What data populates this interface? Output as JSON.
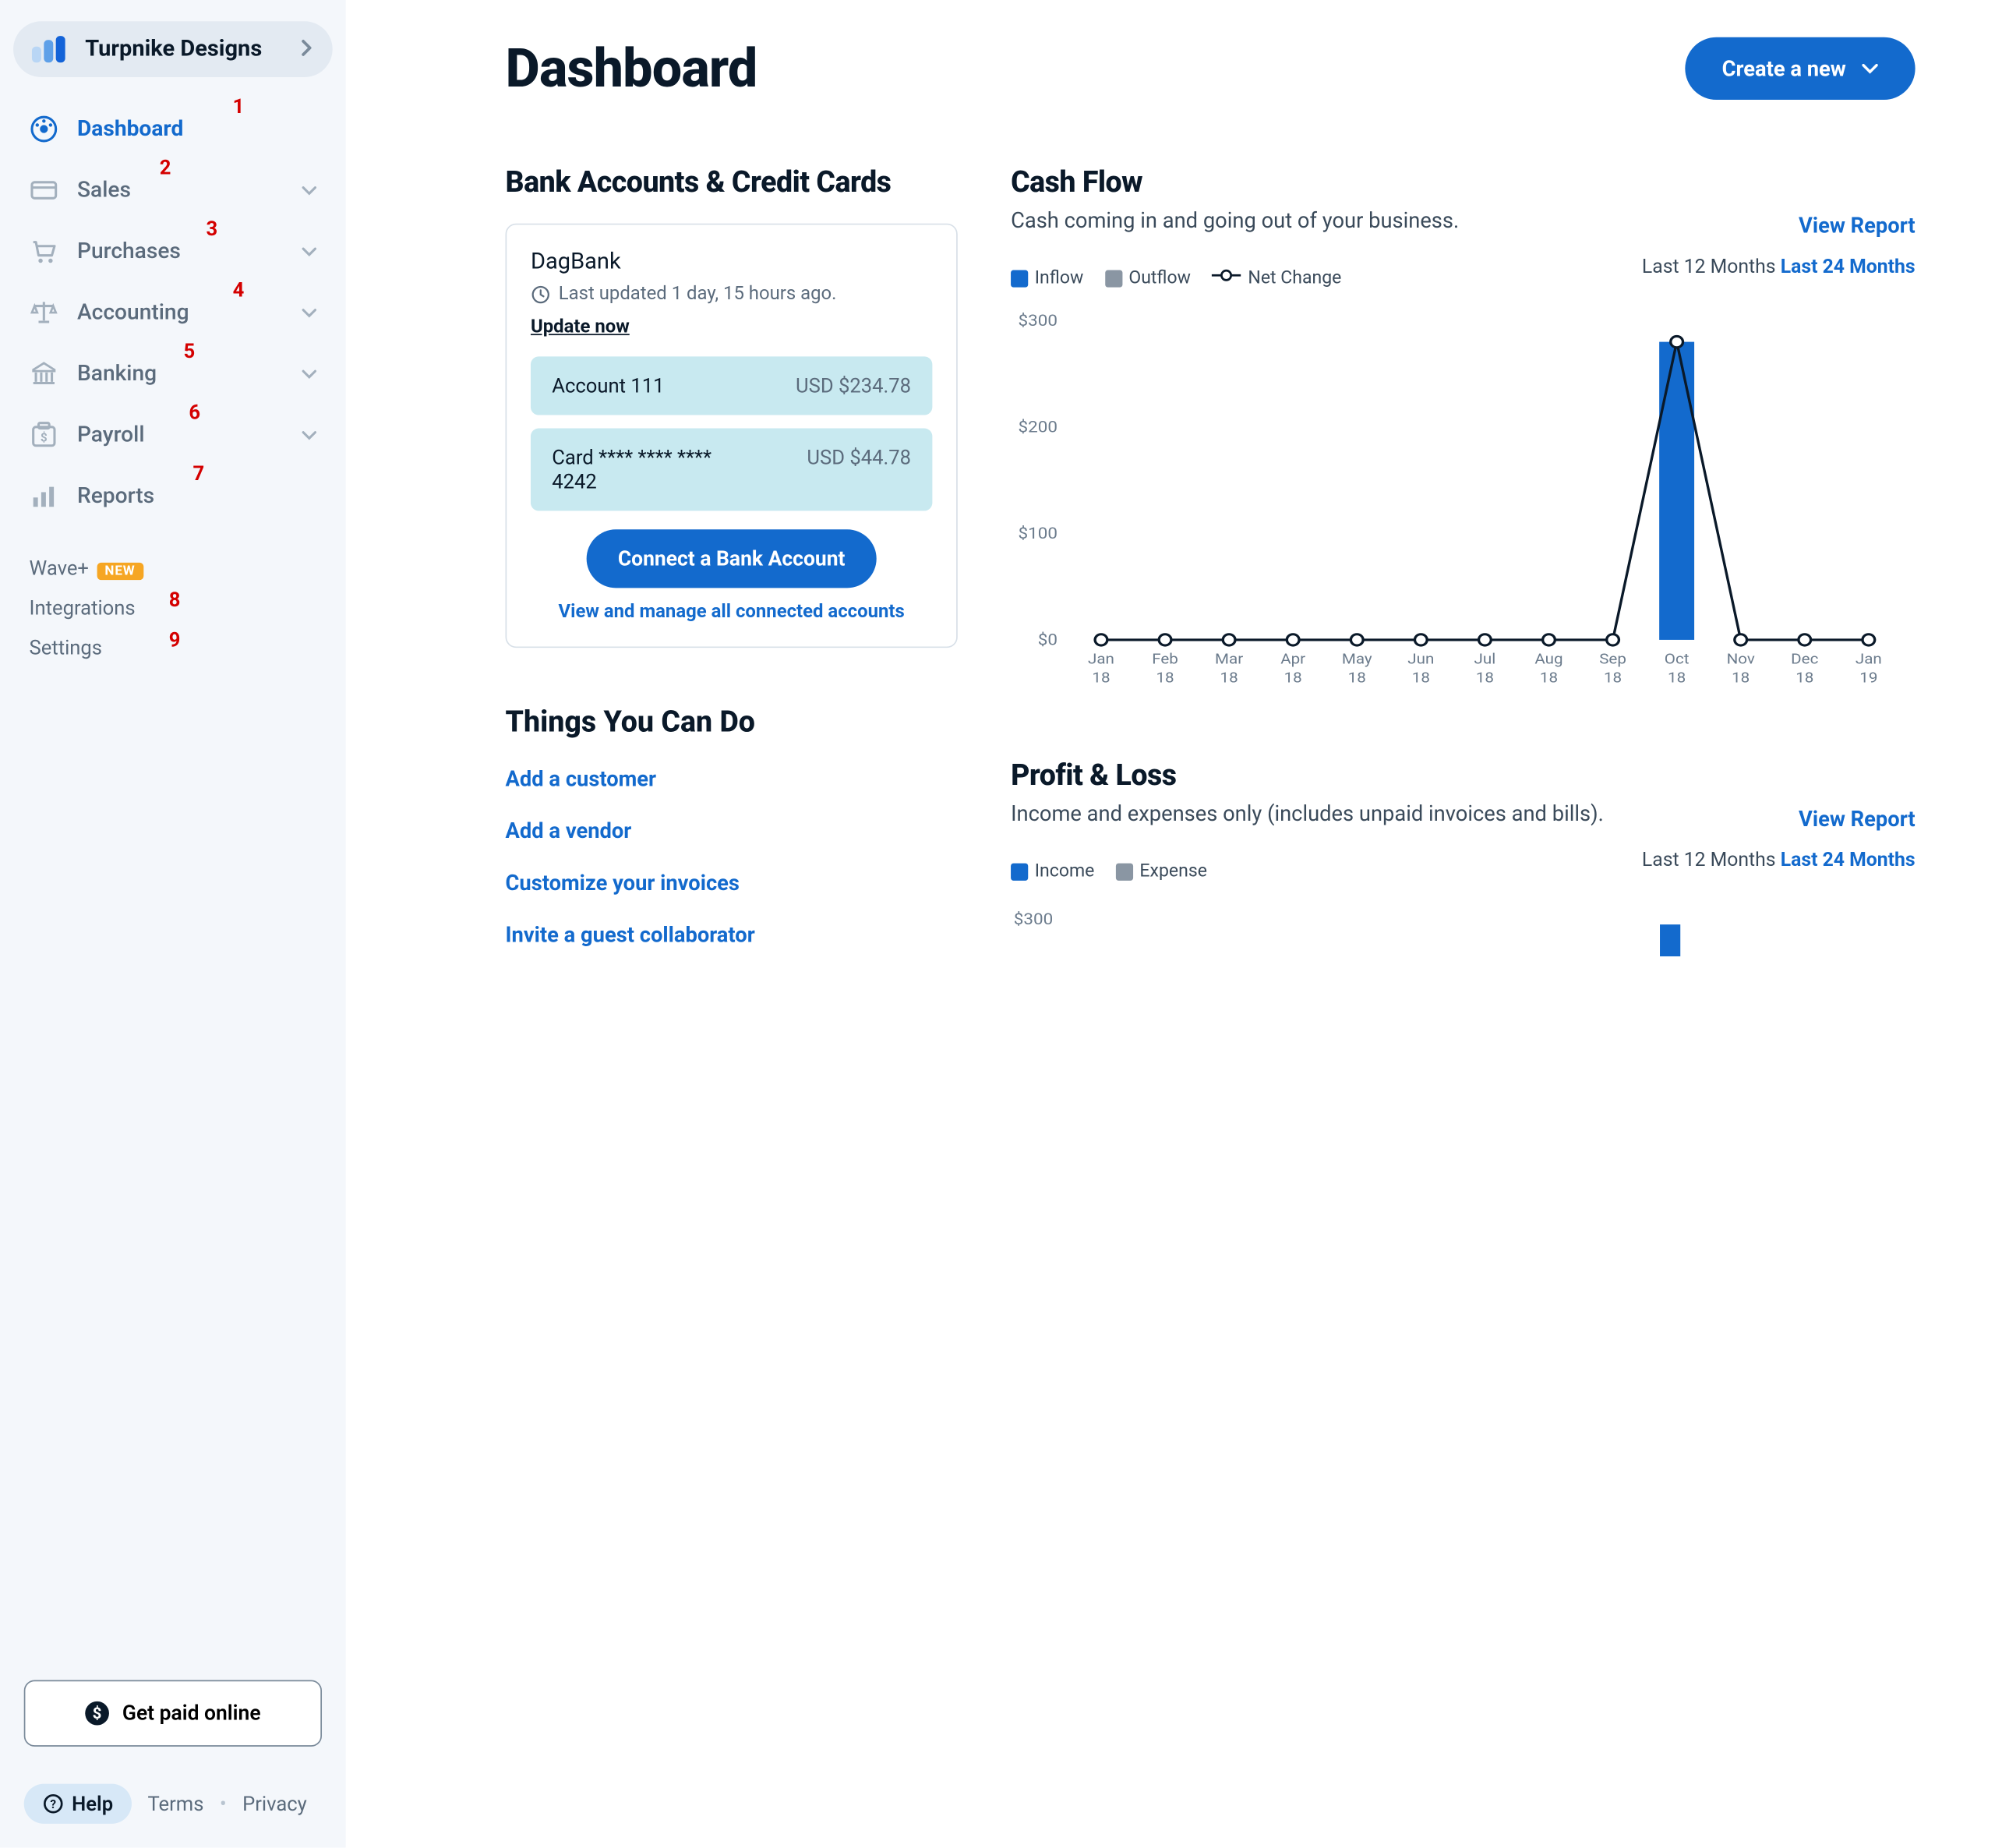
{
  "business_name": "Turpnike Designs",
  "sidebar": {
    "items": [
      {
        "label": "Dashboard",
        "icon": "dashboard-icon",
        "active": true,
        "expandable": false,
        "num": "1"
      },
      {
        "label": "Sales",
        "icon": "card-icon",
        "active": false,
        "expandable": true,
        "num": "2"
      },
      {
        "label": "Purchases",
        "icon": "cart-icon",
        "active": false,
        "expandable": true,
        "num": "3"
      },
      {
        "label": "Accounting",
        "icon": "scale-icon",
        "active": false,
        "expandable": true,
        "num": "4"
      },
      {
        "label": "Banking",
        "icon": "bank-icon",
        "active": false,
        "expandable": true,
        "num": "5"
      },
      {
        "label": "Payroll",
        "icon": "payroll-icon",
        "active": false,
        "expandable": true,
        "num": "6"
      },
      {
        "label": "Reports",
        "icon": "reports-icon",
        "active": false,
        "expandable": false,
        "num": "7"
      }
    ],
    "secondary": [
      {
        "label": "Wave+",
        "badge": "NEW",
        "num": ""
      },
      {
        "label": "Integrations",
        "num": "8"
      },
      {
        "label": "Settings",
        "num": "9"
      }
    ],
    "get_paid": "Get paid online",
    "help": "Help",
    "terms": "Terms",
    "privacy": "Privacy"
  },
  "page": {
    "title": "Dashboard",
    "create_label": "Create a new"
  },
  "bank": {
    "heading": "Bank Accounts & Credit Cards",
    "name": "DagBank",
    "updated": "Last updated 1 day, 15 hours ago.",
    "update_now": "Update now",
    "accounts": [
      {
        "name": "Account 111",
        "amount": "USD $234.78"
      },
      {
        "name": "Card **** **** **** 4242",
        "amount": "USD $44.78"
      }
    ],
    "connect": "Connect a Bank Account",
    "view_all": "View and manage all connected accounts"
  },
  "things": {
    "heading": "Things You Can Do",
    "links": [
      "Add a customer",
      "Add a vendor",
      "Customize your invoices",
      "Invite a guest collaborator"
    ]
  },
  "cashflow": {
    "heading": "Cash Flow",
    "sub": "Cash coming in and going out of your business.",
    "report": "View Report",
    "legend": {
      "inflow": "Inflow",
      "outflow": "Outflow",
      "net": "Net Change"
    },
    "range": {
      "r1": "Last 12 Months",
      "r2": "Last 24 Months"
    }
  },
  "pl": {
    "heading": "Profit & Loss",
    "sub": "Income and expenses only (includes unpaid invoices and bills).",
    "report": "View Report",
    "legend": {
      "income": "Income",
      "expense": "Expense"
    },
    "range": {
      "r1": "Last 12 Months",
      "r2": "Last 24 Months"
    },
    "ytick": "$300"
  },
  "chart_data": {
    "type": "bar",
    "title": "Cash Flow",
    "xlabel": "",
    "ylabel": "",
    "ylim": [
      0,
      300
    ],
    "yticks": [
      0,
      100,
      200,
      300
    ],
    "ytick_labels": [
      "$0",
      "$100",
      "$200",
      "$300"
    ],
    "categories": [
      "Jan 18",
      "Feb 18",
      "Mar 18",
      "Apr 18",
      "May 18",
      "Jun 18",
      "Jul 18",
      "Aug 18",
      "Sep 18",
      "Oct 18",
      "Nov 18",
      "Dec 18",
      "Jan 19"
    ],
    "series": [
      {
        "name": "Inflow",
        "color": "#136acd",
        "values": [
          0,
          0,
          0,
          0,
          0,
          0,
          0,
          0,
          0,
          280,
          0,
          0,
          0
        ]
      },
      {
        "name": "Outflow",
        "color": "#8a96a3",
        "values": [
          0,
          0,
          0,
          0,
          0,
          0,
          0,
          0,
          0,
          0,
          0,
          0,
          0
        ]
      },
      {
        "name": "Net Change",
        "type": "line",
        "color": "#0a1929",
        "values": [
          0,
          0,
          0,
          0,
          0,
          0,
          0,
          0,
          0,
          280,
          0,
          0,
          0
        ]
      }
    ]
  },
  "colors": {
    "accent": "#136acd",
    "muted": "#8a96a3"
  }
}
